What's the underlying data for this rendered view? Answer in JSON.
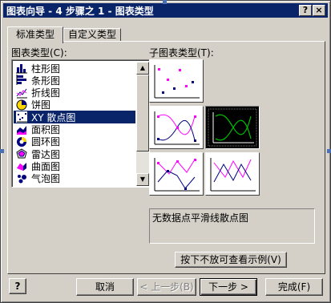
{
  "window": {
    "title": "图表向导 - 4 步骤之 1 - 图表类型",
    "help_btn": "?",
    "close_btn": "×"
  },
  "tabs": [
    {
      "label": "标准类型",
      "active": true
    },
    {
      "label": "自定义类型",
      "active": false
    }
  ],
  "chart_type_label": "图表类型(C):",
  "chart_types": [
    {
      "label": "柱形图",
      "icon": "column-chart-icon"
    },
    {
      "label": "条形图",
      "icon": "bar-chart-icon"
    },
    {
      "label": "折线图",
      "icon": "line-chart-icon"
    },
    {
      "label": "饼图",
      "icon": "pie-chart-icon"
    },
    {
      "label": "XY 散点图",
      "icon": "scatter-chart-icon",
      "selected": true
    },
    {
      "label": "面积图",
      "icon": "area-chart-icon"
    },
    {
      "label": "圆环图",
      "icon": "doughnut-chart-icon"
    },
    {
      "label": "雷达图",
      "icon": "radar-chart-icon"
    },
    {
      "label": "曲面图",
      "icon": "surface-chart-icon"
    },
    {
      "label": "气泡图",
      "icon": "bubble-chart-icon"
    }
  ],
  "subtype_label": "子图表类型(T):",
  "subtype_description": "无数据点平滑线散点图",
  "preview_button": "按下不放可查看示例(V)",
  "footer": {
    "help_icon": "?",
    "cancel": "取消",
    "back": "< 上一步(B)",
    "next": "下一步 >",
    "finish": "完成(F)"
  },
  "colors": {
    "title_bar": "#0a246a",
    "face": "#d4d0c8",
    "selection": "#0a246a",
    "marker_magenta": "#ff00ff",
    "marker_navy": "#000080",
    "smooth_line_green": "#00c000"
  }
}
